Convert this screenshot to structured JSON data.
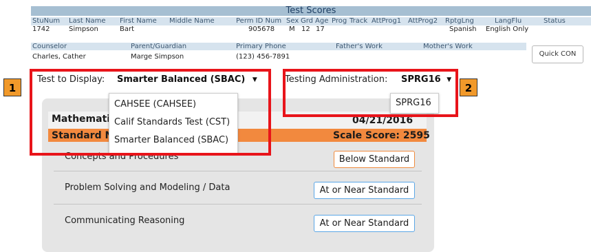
{
  "header": {
    "title": "Test Scores"
  },
  "student_columns": [
    "StuNum",
    "Last Name",
    "First Name",
    "Middle Name",
    "Perm ID Num",
    "Sex",
    "Grd",
    "Age",
    "Prog",
    "Track",
    "AttProg1",
    "AttProg2",
    "RptgLng",
    "LangFlu",
    "Status"
  ],
  "student_values": {
    "stunum": "1742",
    "last": "Simpson",
    "first": "Bart",
    "perm": "905678",
    "sex": "M",
    "grd": "12",
    "age": "17",
    "rptg": "Spanish",
    "langflu": "English Only"
  },
  "contact_columns": [
    "Counselor",
    "Parent/Guardian",
    "Primary Phone",
    "Father's Work",
    "Mother's Work"
  ],
  "contact_values": {
    "counselor": "Charles, Cather",
    "parent": "Marge Simpson",
    "phone": "(123) 456-7891"
  },
  "quick_button": "Quick CON",
  "test_display": {
    "label": "Test to Display:",
    "selected": "Smarter Balanced (SBAC)",
    "options": [
      "CAHSEE (CAHSEE)",
      "Calif Standards Test (CST)",
      "Smarter Balanced (SBAC)"
    ]
  },
  "testing_admin": {
    "label": "Testing Administration:",
    "selected": "SPRG16",
    "options": [
      "SPRG16"
    ]
  },
  "result": {
    "subject": "Mathematic",
    "date": "04/21/2016",
    "standard_label": "Standard N",
    "scale_score": "Scale Score: 2595",
    "claims": [
      {
        "name": "Concepts and Procedures",
        "level": "Below Standard"
      },
      {
        "name": "Problem Solving and Modeling / Data",
        "level": "At or Near Standard"
      },
      {
        "name": "Communicating Reasoning",
        "level": "At or Near Standard"
      }
    ]
  },
  "callouts": [
    "1",
    "2"
  ],
  "colors": {
    "accent": "#f2893e",
    "callout": "#e8141a",
    "header": "#a6bfd2",
    "badge_blue": "#5aa6e6"
  }
}
